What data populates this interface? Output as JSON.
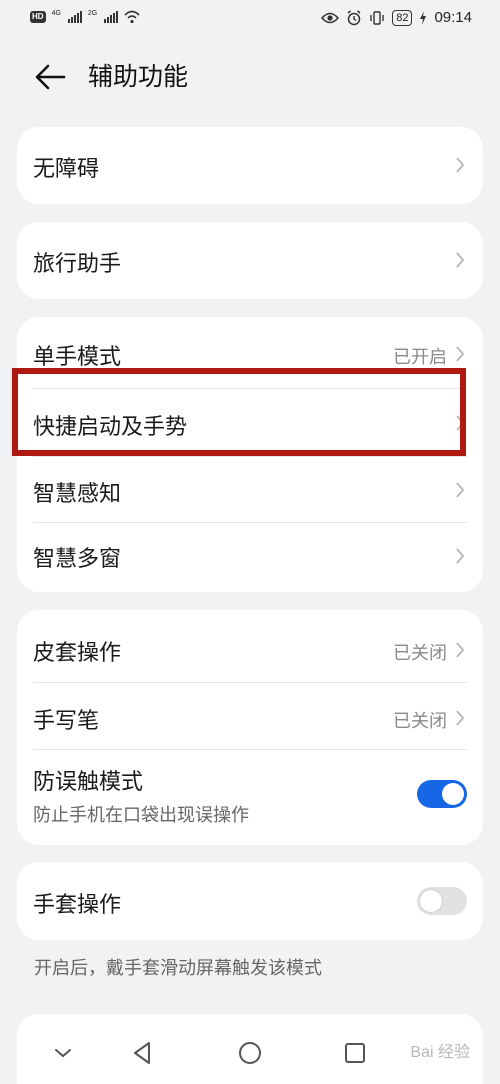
{
  "status_bar": {
    "hd_label": "HD",
    "sim1_net": "4G",
    "sim2_net": "2G",
    "battery": "82",
    "time": "09:14",
    "icons": [
      "eye-icon",
      "alarm-icon",
      "vibrate-icon",
      "battery-icon",
      "charging-icon"
    ]
  },
  "header": {
    "title": "辅助功能",
    "back_icon": "back-arrow-icon"
  },
  "groups": [
    {
      "items": [
        {
          "label": "无障碍"
        }
      ]
    },
    {
      "items": [
        {
          "label": "旅行助手"
        }
      ]
    },
    {
      "items": [
        {
          "label": "单手模式",
          "value": "已开启"
        },
        {
          "label": "快捷启动及手势"
        },
        {
          "label": "智慧感知"
        },
        {
          "label": "智慧多窗"
        }
      ]
    },
    {
      "items": [
        {
          "label": "皮套操作",
          "value": "已关闭"
        },
        {
          "label": "手写笔",
          "value": "已关闭"
        },
        {
          "label": "防误触模式",
          "sublabel": "防止手机在口袋出现误操作",
          "toggle": true
        }
      ]
    },
    {
      "items": [
        {
          "label": "手套操作",
          "toggle": false
        }
      ]
    }
  ],
  "footnote": "开启后，戴手套滑动屏幕触发该模式",
  "colors": {
    "accent": "#1766e6",
    "highlight": "#b01812",
    "background": "#f1f2f4"
  },
  "nav": [
    "nav-down-icon",
    "nav-back-icon",
    "nav-home-icon",
    "nav-recents-icon"
  ],
  "watermark": "Bai 经验"
}
